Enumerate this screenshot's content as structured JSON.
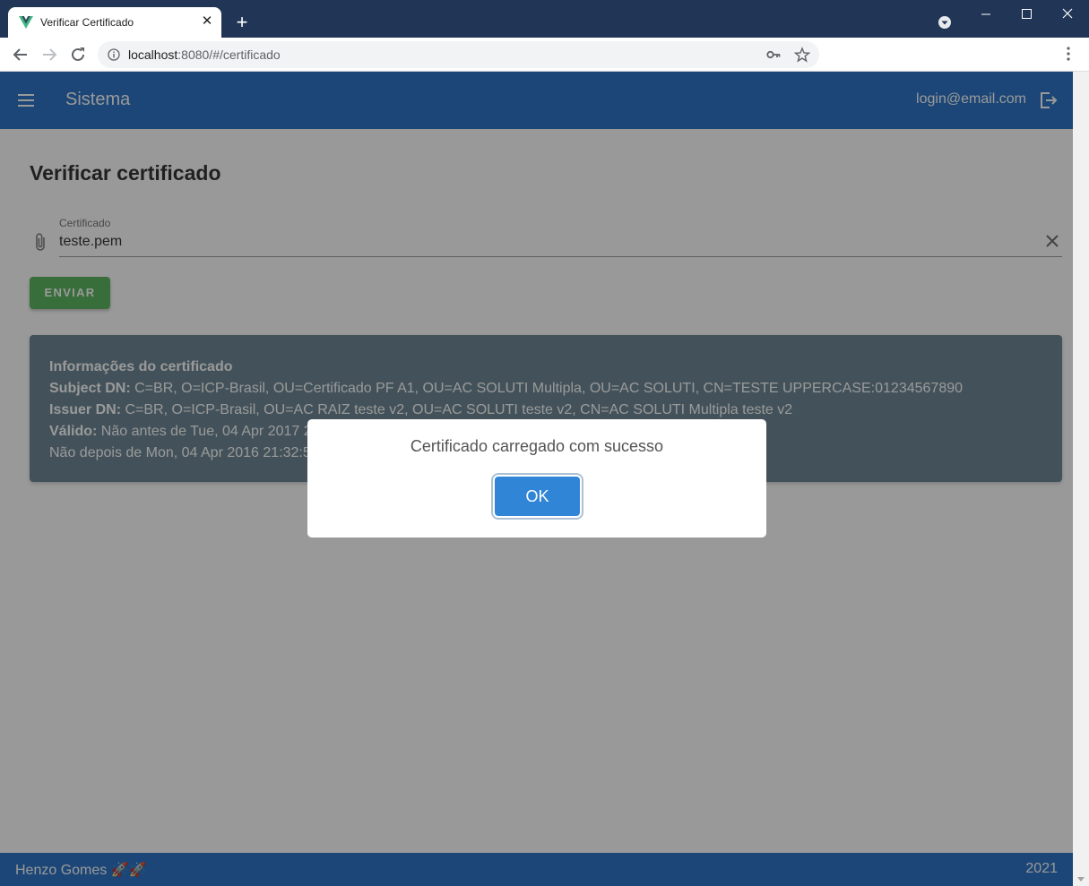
{
  "browser": {
    "tab_title": "Verificar Certificado",
    "url_host": "localhost",
    "url_path": ":8080/#/certificado",
    "extension_badge": "2",
    "extensions": [
      "ublock-icon",
      "dss-icon",
      "vue-devtools-icon",
      "vuetify-icon",
      "grammarly-icon",
      "puzzle-icon",
      "reading-list-icon"
    ]
  },
  "appbar": {
    "title": "Sistema",
    "user_email": "login@email.com"
  },
  "page": {
    "title": "Verificar certificado",
    "field_label": "Certificado",
    "field_value": "teste.pem",
    "send_label": "ENVIAR"
  },
  "certificate_info": {
    "heading": "Informações do certificado",
    "subject_label": "Subject DN:",
    "subject_value": " C=BR, O=ICP-Brasil, OU=Certificado PF A1, OU=AC SOLUTI Multipla, OU=AC SOLUTI, CN=TESTE UPPERCASE:01234567890",
    "issuer_label": "Issuer DN:",
    "issuer_value": " C=BR, O=ICP-Brasil, OU=AC RAIZ teste v2, OU=AC SOLUTI teste v2, CN=AC SOLUTI Multipla teste v2",
    "valid_label": "Válido:",
    "valid_value": " Não antes de Tue, 04 Apr 2017 21",
    "not_after": "Não depois de Mon, 04 Apr 2016 21:32:5"
  },
  "footer": {
    "author": "Henzo Gomes 🚀🚀",
    "year": "2021"
  },
  "dialog": {
    "message": "Certificado carregado com sucesso",
    "ok_label": "OK"
  },
  "colors": {
    "primary": "#1867c0",
    "success": "#4caf50",
    "card": "#607d8b",
    "confirm": "#3085d6"
  }
}
